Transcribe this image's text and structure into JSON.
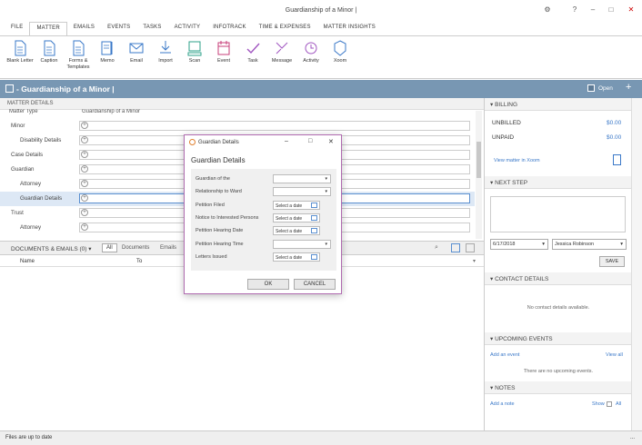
{
  "window": {
    "title": "Guardianship of a Minor |",
    "help": "?",
    "min": "–",
    "max": "□",
    "close": "✕"
  },
  "menu": {
    "tabs": [
      "FILE",
      "MATTER",
      "EMAILS",
      "EVENTS",
      "TASKS",
      "ACTIVITY",
      "INFOTRACK",
      "TIME & EXPENSES",
      "MATTER INSIGHTS"
    ]
  },
  "ribbon": {
    "buttons": [
      {
        "label": "Blank Letter",
        "icon": "document-icon"
      },
      {
        "label": "Caption",
        "icon": "document-icon"
      },
      {
        "label": "Forms & Templates",
        "icon": "document-icon"
      },
      {
        "label": "Memo",
        "icon": "memo-icon"
      },
      {
        "label": "Email",
        "icon": "envelope-icon"
      },
      {
        "label": "Import",
        "icon": "download-icon"
      },
      {
        "label": "Scan",
        "icon": "scanner-icon"
      },
      {
        "label": "Event",
        "icon": "calendar-icon"
      },
      {
        "label": "Task",
        "icon": "check-icon"
      },
      {
        "label": "Message",
        "icon": "message-icon"
      },
      {
        "label": "Activity",
        "icon": "activity-icon"
      },
      {
        "label": "Xoom",
        "icon": "xoom-icon"
      }
    ]
  },
  "matter": {
    "title": "- Guardianship of a Minor |",
    "open_label": "Open"
  },
  "details": {
    "header": "MATTER DETAILS",
    "partial_row": "Matter Type",
    "partial_value": "Guardianship of a Minor",
    "rows": [
      {
        "label": "Minor",
        "indent": false
      },
      {
        "label": "Disability Details",
        "indent": true
      },
      {
        "label": "Case Details",
        "indent": false
      },
      {
        "label": "Guardian",
        "indent": false
      },
      {
        "label": "Attorney",
        "indent": true
      },
      {
        "label": "Guardian Details",
        "indent": true
      },
      {
        "label": "Trust",
        "indent": false
      },
      {
        "label": "Attorney",
        "indent": true
      }
    ]
  },
  "docs": {
    "title": "DOCUMENTS & EMAILS (0) ▾",
    "filters": [
      "All",
      "Documents",
      "Emails"
    ],
    "columns": [
      "Name",
      "To"
    ]
  },
  "status": {
    "text": "Files are up to date",
    "more": "..."
  },
  "billing": {
    "header": "BILLING",
    "unbilled_label": "UNBILLED",
    "unbilled_value": "$0.00",
    "unpaid_label": "UNPAID",
    "unpaid_value": "$0.00",
    "xoom_link": "View matter in Xoom"
  },
  "next_step": {
    "header": "NEXT STEP",
    "date": "6/17/2018",
    "person": "Jessica Robinson",
    "save": "SAVE"
  },
  "contact": {
    "header": "CONTACT DETAILS",
    "empty": "No contact details available."
  },
  "upcoming": {
    "header": "UPCOMING EVENTS",
    "add": "Add an event",
    "view_all": "View all",
    "empty": "There are no upcoming events."
  },
  "notes": {
    "header": "NOTES",
    "add": "Add a note",
    "show": "Show",
    "all": "All"
  },
  "dialog": {
    "title": "Guardian Details",
    "heading": "Guardian Details",
    "fields": [
      {
        "label": "Guardian of the",
        "value": "",
        "type": "select"
      },
      {
        "label": "Relationship to Ward",
        "value": "",
        "type": "select"
      },
      {
        "label": "Petition Filed",
        "value": "Select a date",
        "type": "date"
      },
      {
        "label": "Notice to Interested Persons",
        "value": "Select a date",
        "type": "date"
      },
      {
        "label": "Petition Hearing Date",
        "value": "Select a date",
        "type": "date"
      },
      {
        "label": "Petition Hearing Time",
        "value": "",
        "type": "select"
      },
      {
        "label": "Letters Issued",
        "value": "Select a date",
        "type": "date"
      }
    ],
    "ok": "OK",
    "cancel": "CANCEL"
  },
  "colors": {
    "accent": "#7897b3",
    "link": "#3a78c8",
    "dialog_border": "#b06bb0"
  }
}
